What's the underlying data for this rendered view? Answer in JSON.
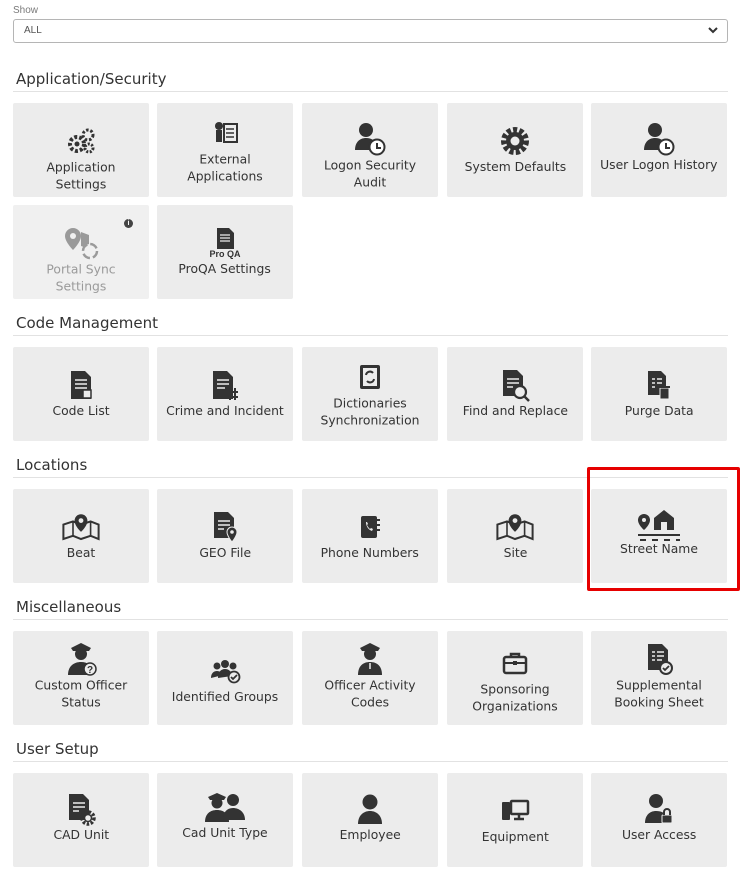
{
  "filter": {
    "label": "Show",
    "value": "ALL"
  },
  "sections": {
    "app": {
      "title": "Application/Security",
      "tiles": [
        {
          "label": "Application Settings",
          "icon": "gears-icon"
        },
        {
          "label": "External Applications",
          "icon": "id-badge-checklist-icon"
        },
        {
          "label": "Logon Security Audit",
          "icon": "user-clock-icon"
        },
        {
          "label": "System Defaults",
          "icon": "gear-icon"
        },
        {
          "label": "User Logon History",
          "icon": "user-clock-icon"
        },
        {
          "label": "Portal Sync Settings",
          "icon": "map-pin-sync-icon",
          "disabled": true,
          "info": "i"
        },
        {
          "label": "ProQA Settings",
          "icon": "proqa-document-icon",
          "badge": "Pro QA"
        }
      ]
    },
    "code": {
      "title": "Code Management",
      "tiles": [
        {
          "label": "Code List",
          "icon": "document-list-icon"
        },
        {
          "label": "Crime and Incident",
          "icon": "document-hash-icon"
        },
        {
          "label": "Dictionaries Synchronization",
          "icon": "book-sync-icon"
        },
        {
          "label": "Find and Replace",
          "icon": "document-search-icon"
        },
        {
          "label": "Purge Data",
          "icon": "document-trash-icon"
        }
      ]
    },
    "locations": {
      "title": "Locations",
      "tiles": [
        {
          "label": "Beat",
          "icon": "map-pin-icon"
        },
        {
          "label": "GEO File",
          "icon": "document-pin-icon"
        },
        {
          "label": "Phone Numbers",
          "icon": "phone-book-icon"
        },
        {
          "label": "Site",
          "icon": "map-pin-icon"
        },
        {
          "label": "Street Name",
          "icon": "street-house-icon"
        }
      ]
    },
    "misc": {
      "title": "Miscellaneous",
      "tiles": [
        {
          "label": "Custom Officer Status",
          "icon": "officer-question-icon"
        },
        {
          "label": "Identified Groups",
          "icon": "group-check-icon"
        },
        {
          "label": "Officer Activity Codes",
          "icon": "officer-icon"
        },
        {
          "label": "Sponsoring Organizations",
          "icon": "briefcase-icon"
        },
        {
          "label": "Supplemental Booking Sheet",
          "icon": "document-check-icon"
        }
      ]
    },
    "user": {
      "title": "User Setup",
      "tiles": [
        {
          "label": "CAD Unit",
          "icon": "document-gear-icon"
        },
        {
          "label": "Cad Unit Type",
          "icon": "officers-icon"
        },
        {
          "label": "Employee",
          "icon": "user-icon"
        },
        {
          "label": "Equipment",
          "icon": "computer-phone-icon"
        },
        {
          "label": "User Access",
          "icon": "user-lock-icon"
        }
      ]
    }
  },
  "colors": {
    "tile_bg": "#ececec",
    "icon": "#333333",
    "highlight": "#e60000"
  }
}
